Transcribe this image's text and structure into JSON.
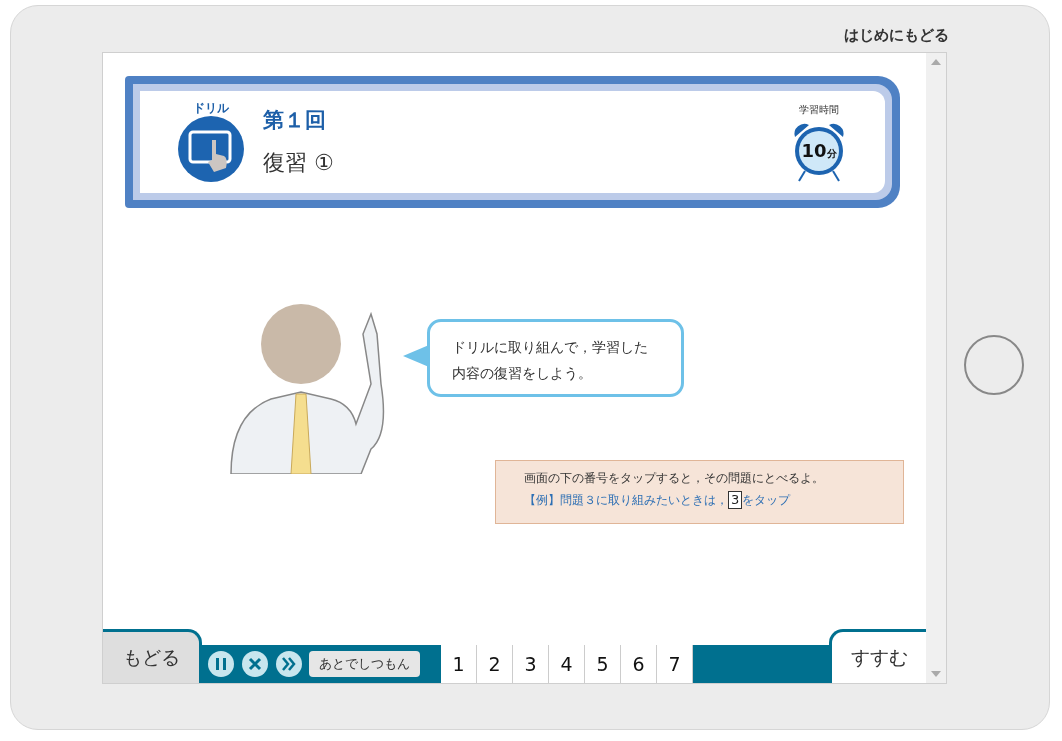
{
  "top_link": "はじめにもどる",
  "header": {
    "badge": "ドリル",
    "round": "第１回",
    "title": "復習 ①",
    "time_label": "学習時間",
    "time_value": "10",
    "time_unit": "分"
  },
  "speech": "ドリルに取り組んで，学習した内容の復習をしよう。",
  "note": {
    "line1": "画面の下の番号をタップすると，その問題にとべるよ。",
    "line2_before": "【例】問題３に取り組みたいときは，",
    "line2_key": "3",
    "line2_after": "をタップ"
  },
  "footer": {
    "back": "もどる",
    "later": "あとでしつもん",
    "next": "すすむ",
    "numbers": [
      "1",
      "2",
      "3",
      "4",
      "5",
      "6",
      "7"
    ]
  }
}
